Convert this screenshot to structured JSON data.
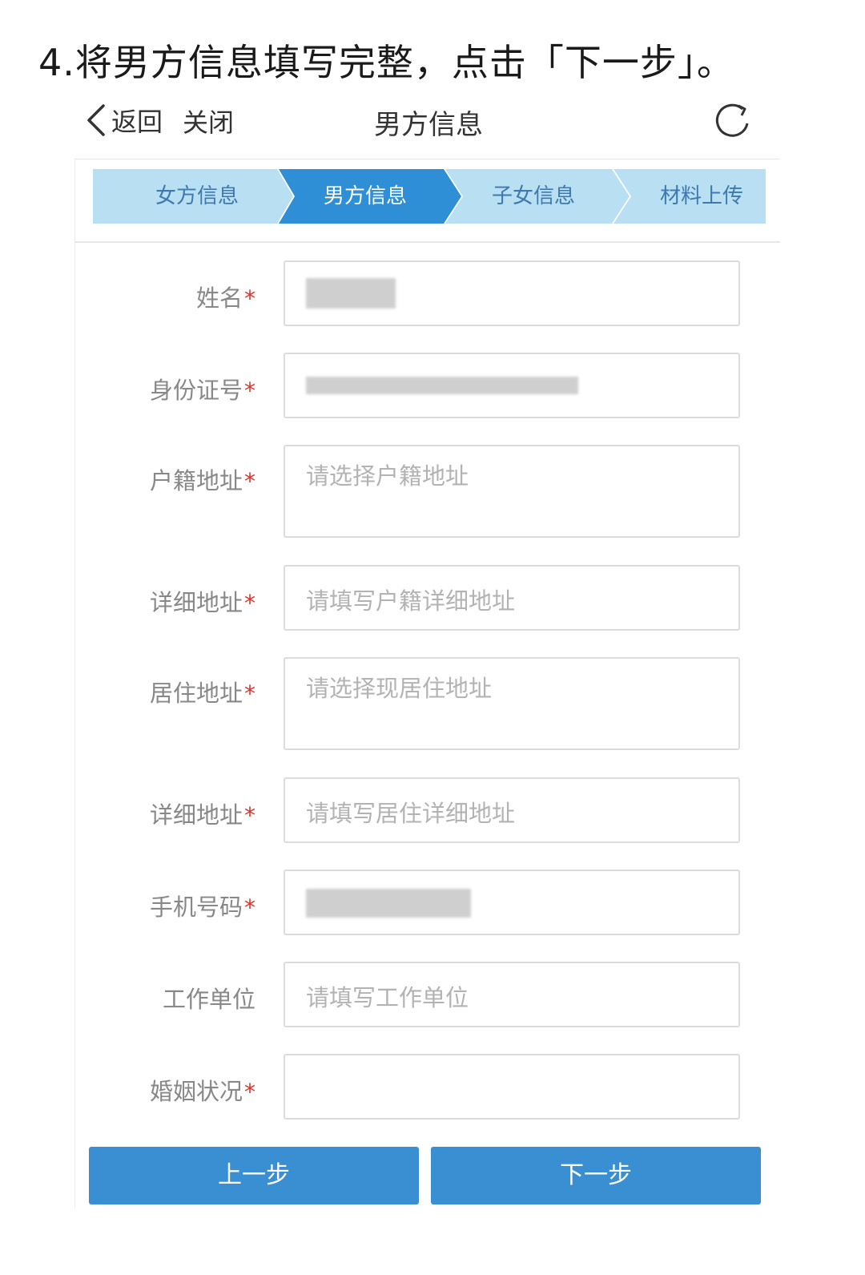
{
  "instruction": "4.将男方信息填写完整，点击「下一步」。",
  "nav": {
    "back_label": "返回",
    "close_label": "关闭",
    "title": "男方信息"
  },
  "steps": [
    {
      "label": "女方信息",
      "active": false
    },
    {
      "label": "男方信息",
      "active": true
    },
    {
      "label": "子女信息",
      "active": false
    },
    {
      "label": "材料上传",
      "active": false
    }
  ],
  "form": {
    "name": {
      "label": "姓名",
      "required": true,
      "value": ""
    },
    "id_number": {
      "label": "身份证号",
      "required": true,
      "value": ""
    },
    "household_address": {
      "label": "户籍地址",
      "required": true,
      "placeholder": "请选择户籍地址"
    },
    "household_detail": {
      "label": "详细地址",
      "required": true,
      "placeholder": "请填写户籍详细地址"
    },
    "residence_address": {
      "label": "居住地址",
      "required": true,
      "placeholder": "请选择现居住地址"
    },
    "residence_detail": {
      "label": "详细地址",
      "required": true,
      "placeholder": "请填写居住详细地址"
    },
    "phone": {
      "label": "手机号码",
      "required": true,
      "value": ""
    },
    "work_unit": {
      "label": "工作单位",
      "required": false,
      "placeholder": "请填写工作单位"
    },
    "marital_status": {
      "label": "婚姻状况",
      "required": true,
      "value": ""
    }
  },
  "buttons": {
    "prev_label": "上一步",
    "next_label": "下一步"
  },
  "colors": {
    "step_active": "#2f8fd6",
    "step_inactive": "#b9dff3",
    "step_active_text": "#ffffff",
    "step_inactive_text": "#3d79b0",
    "button_bg": "#3a8fd3",
    "required_star": "#d9342b"
  },
  "icons": {
    "back": "chevron-left-icon",
    "refresh": "refresh-icon"
  }
}
